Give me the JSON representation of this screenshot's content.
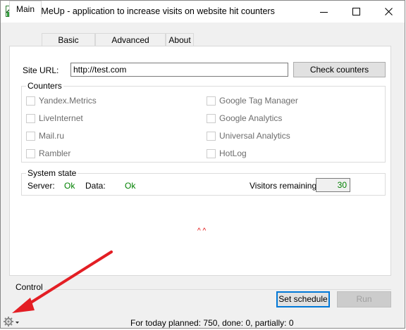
{
  "window": {
    "title": "RateMeUp - application to increase visits on website hit counters",
    "icon": "chart-app-icon",
    "controls": [
      "minimize-icon",
      "maximize-icon",
      "close-icon"
    ]
  },
  "tabs": [
    {
      "label": "Main",
      "active": true
    },
    {
      "label": "Basic settings",
      "active": false
    },
    {
      "label": "Advanced settings",
      "active": false
    },
    {
      "label": "About",
      "active": false
    }
  ],
  "main": {
    "site_url_label": "Site URL:",
    "site_url_value": "http://test.com",
    "check_button": "Check counters",
    "counters_title": "Counters",
    "counters_left": [
      "Yandex.Metrics",
      "LiveInternet",
      "Mail.ru",
      "Rambler"
    ],
    "counters_right": [
      "Google Tag Manager",
      "Google Analytics",
      "Universal Analytics",
      "HotLog"
    ],
    "system_state": {
      "title": "System state",
      "server_label": "Server:",
      "server_value": "Ok",
      "data_label": "Data:",
      "data_value": "Ok",
      "visitors_label": "Visitors remaining:",
      "visitors_value": "30"
    },
    "marker": "^ ^"
  },
  "control": {
    "title": "Control",
    "set_schedule": "Set schedule",
    "run": "Run"
  },
  "status": {
    "text": "For today planned: 750, done: 0, partially: 0"
  },
  "colors": {
    "ok": "#008000",
    "marker": "#e00000",
    "focus": "#0078d7",
    "arrow": "#e31e24"
  }
}
